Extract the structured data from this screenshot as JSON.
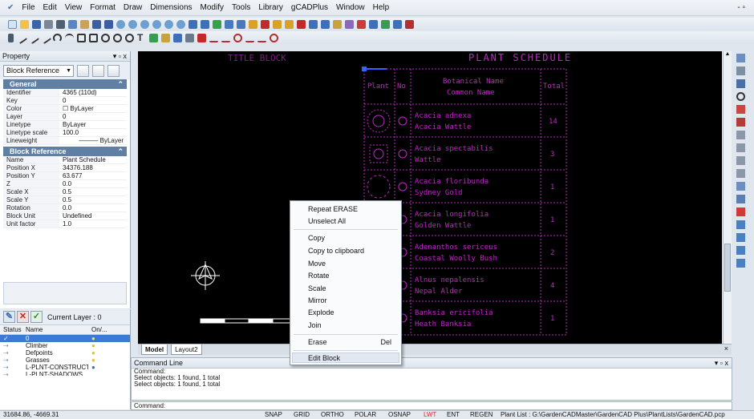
{
  "menu": [
    "File",
    "Edit",
    "View",
    "Format",
    "Draw",
    "Dimensions",
    "Modify",
    "Tools",
    "Library",
    "gCADPlus",
    "Window",
    "Help"
  ],
  "window_controls": "- ▫",
  "property": {
    "title": "Property",
    "controls": "▾ ▫ x",
    "selector": "Block Reference",
    "general_header": "General",
    "general": [
      {
        "key": "Identifier",
        "value": "4365 (110d)"
      },
      {
        "key": "Key",
        "value": "0"
      },
      {
        "key": "Color",
        "value": "☐ ByLayer"
      },
      {
        "key": "Layer",
        "value": "0"
      },
      {
        "key": "Linetype",
        "value": "ByLayer"
      },
      {
        "key": "Linetype scale",
        "value": "100.0"
      },
      {
        "key": "Lineweight",
        "value": "——— ByLayer"
      }
    ],
    "block_header": "Block Reference",
    "block": [
      {
        "key": "Name",
        "value": "Plant Schedule"
      },
      {
        "key": "Position X",
        "value": "34376.188"
      },
      {
        "key": "Position Y",
        "value": "63.677"
      },
      {
        "key": "Z",
        "value": "0.0"
      },
      {
        "key": "Scale X",
        "value": "0.5"
      },
      {
        "key": "Scale Y",
        "value": "0.5"
      },
      {
        "key": "Rotation",
        "value": "0.0"
      },
      {
        "key": "Block Unit",
        "value": "Undefined"
      },
      {
        "key": "Unit factor",
        "value": "1.0"
      }
    ]
  },
  "layers": {
    "current": "Current Layer : 0",
    "headers": {
      "status": "Status",
      "name": "Name",
      "onoff": "On/..."
    },
    "rows": [
      {
        "status": "✓",
        "name": "0"
      },
      {
        "status": "⇢",
        "name": "Climber"
      },
      {
        "status": "⇢",
        "name": "Defpoints"
      },
      {
        "status": "⇢",
        "name": "Grasses"
      },
      {
        "status": "⇢",
        "name": "L-PLNT-CONSTRUCTIO"
      },
      {
        "status": "⇢",
        "name": "L-PLNT-SHADOWS"
      }
    ]
  },
  "schedule": {
    "title": "PLANT SCHEDULE",
    "headers": {
      "plant": "Plant",
      "no": "No",
      "name1": "Botanical Name",
      "name2": "Common Name",
      "total": "Total"
    },
    "rows": [
      {
        "botanical": "Acacia adnexa",
        "common": "Acacia Wattle",
        "total": "14"
      },
      {
        "botanical": "Acacia spectabilis",
        "common": "Wattle",
        "total": "3"
      },
      {
        "botanical": "Acacia floribunda",
        "common": "Sydney Gold",
        "total": "1"
      },
      {
        "botanical": "Acacia longifolia",
        "common": "Golden Wattle",
        "total": "1"
      },
      {
        "botanical": "Adenanthos sericeus",
        "common": "Coastal Woolly Bush",
        "total": "2"
      },
      {
        "botanical": "Alnus nepalensis",
        "common": "Nepal Alder",
        "total": "4"
      },
      {
        "botanical": "Banksia ericifolia",
        "common": "Heath Banksia",
        "total": "1"
      }
    ]
  },
  "canvas_top_label": "TITLE BLOCK",
  "context_menu": {
    "items": [
      "Repeat ERASE",
      "Unselect All",
      "Copy",
      "Copy to clipboard",
      "Move",
      "Rotate",
      "Scale",
      "Mirror",
      "Explode",
      "Join",
      "Erase",
      "Edit Block"
    ],
    "erase_shortcut": "Del"
  },
  "tabs": [
    "Model",
    "Layout2"
  ],
  "command": {
    "title": "Command Line",
    "controls": "▾ ▫ x",
    "lines": [
      "Command:",
      "Select objects: 1 found, 1 total",
      "Select objects: 1 found, 1 total"
    ],
    "prompt": "Command:"
  },
  "status": {
    "coords": "31684.86, -4669.31",
    "buttons": [
      "SNAP",
      "GRID",
      "ORTHO",
      "POLAR",
      "OSNAP",
      "LWT",
      "ENT",
      "REGEN"
    ],
    "path": "Plant List : G:\\GardenCADMaster\\GardenCAD Plus\\PlantLists\\GardenCAD.pcp"
  },
  "colors": {
    "accent": "#c026c6",
    "canvas": "#000000",
    "lwt": "#e0262b"
  }
}
